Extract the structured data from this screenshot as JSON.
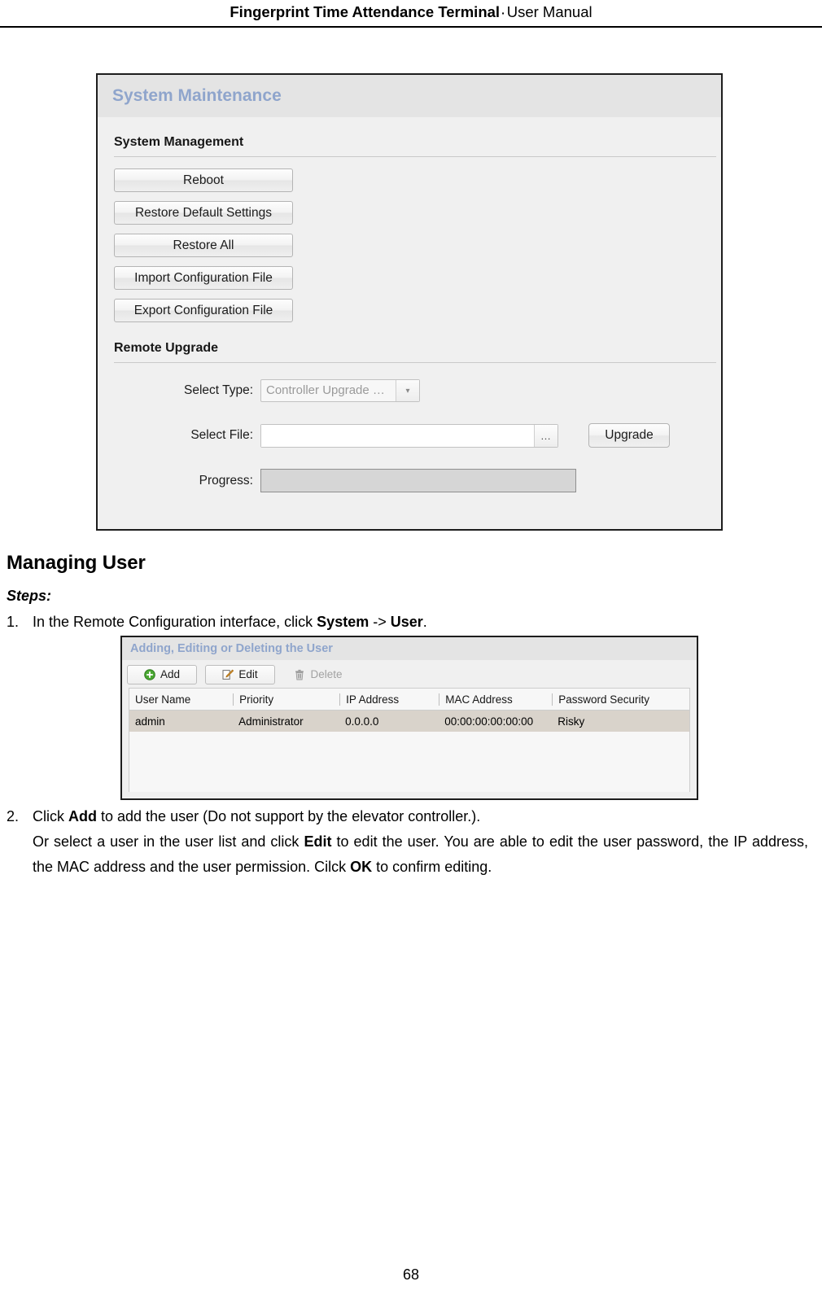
{
  "header": {
    "title_bold": "Fingerprint Time Attendance Terminal",
    "separator": "·",
    "title_regular": "User Manual"
  },
  "figure_system_maintenance": {
    "window_title": "System Maintenance",
    "section_system_management": "System Management",
    "buttons": [
      {
        "label": "Reboot",
        "name": "reboot-button"
      },
      {
        "label": "Restore Default Settings",
        "name": "restore-default-settings-button"
      },
      {
        "label": "Restore All",
        "name": "restore-all-button"
      },
      {
        "label": "Import Configuration File",
        "name": "import-configuration-file-button"
      },
      {
        "label": "Export Configuration File",
        "name": "export-configuration-file-button"
      }
    ],
    "section_remote_upgrade": "Remote Upgrade",
    "select_type": {
      "label": "Select Type:",
      "value": "Controller Upgrade …"
    },
    "select_file": {
      "label": "Select File:",
      "value": "",
      "browse_label": "…"
    },
    "upgrade_button_label": "Upgrade",
    "progress": {
      "label": "Progress:",
      "value": ""
    }
  },
  "body": {
    "heading": "Managing User",
    "steps_label": "Steps:",
    "step1": {
      "number": "1.",
      "text_a": "In the Remote Configuration interface, click ",
      "bold_a": "System",
      "text_b": " -> ",
      "bold_b": "User",
      "text_c": "."
    },
    "step2": {
      "number": "2.",
      "line1_a": "Click ",
      "line1_bold": "Add",
      "line1_b": " to add the user (Do not support by the elevator controller.).",
      "line2_a": "Or select a user in the user list and click ",
      "line2_bold": "Edit",
      "line2_b": " to edit the user. You are able to edit the user password, the IP address, the MAC address and the user permission. Cilck ",
      "line2_bold2": "OK",
      "line2_c": " to confirm editing."
    }
  },
  "figure_user_management": {
    "window_title": "Adding, Editing or Deleting the User",
    "toolbar": [
      {
        "label": "Add",
        "icon": "add-circle-icon",
        "disabled": false
      },
      {
        "label": "Edit",
        "icon": "pencil-edit-icon",
        "disabled": false
      },
      {
        "label": "Delete",
        "icon": "trash-delete-icon",
        "disabled": true
      }
    ],
    "table": {
      "columns": [
        "User Name",
        "Priority",
        "IP Address",
        "MAC Address",
        "Password Security"
      ],
      "rows": [
        {
          "user_name": "admin",
          "priority": "Administrator",
          "ip_address": "0.0.0.0",
          "mac_address": "00:00:00:00:00:00",
          "password_security": "Risky",
          "selected": true
        }
      ]
    }
  },
  "footer": {
    "page_number": "68"
  },
  "colors": {
    "panel_title_blue": "#8fa5cc",
    "panel_background": "#f0f0f0",
    "titlebar_background": "#e4e4e4",
    "selected_row": "#d9d3cb",
    "progress_track": "#d6d6d6",
    "add_icon_green": "#4aa832",
    "edit_icon_orange": "#e8a33d"
  }
}
